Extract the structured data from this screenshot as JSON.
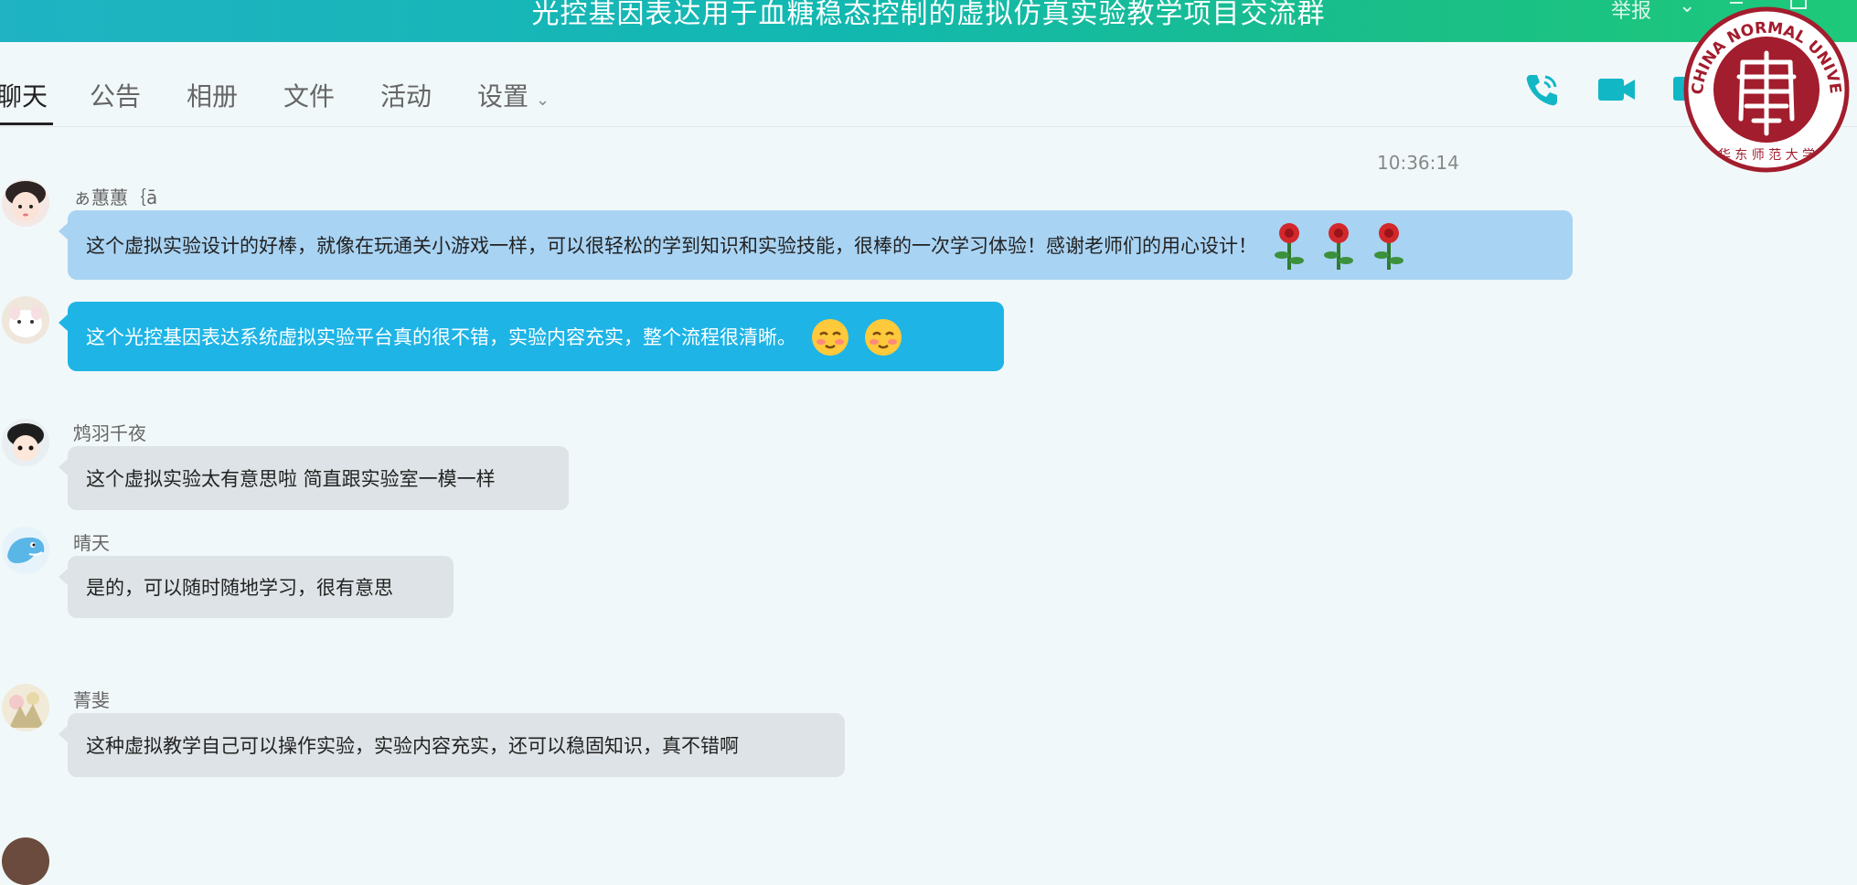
{
  "window": {
    "title": "光控基因表达用于血糖稳态控制的虚拟仿真实验教学项目交流群",
    "report_label": "举报"
  },
  "tabs": [
    {
      "label": "聊天",
      "active": true
    },
    {
      "label": "公告"
    },
    {
      "label": "相册"
    },
    {
      "label": "文件"
    },
    {
      "label": "活动"
    },
    {
      "label": "设置"
    }
  ],
  "toolbar_icons": [
    "phone-icon",
    "video-call-icon",
    "screen-share-icon"
  ],
  "logo": {
    "text": "EAST CHINA NORMAL UNIVERSITY",
    "seal_text": "华东师范大学"
  },
  "chat": {
    "timestamp": "10:36:14",
    "messages": [
      {
        "sender": "ぁ蕙蕙｛ā",
        "text": "这个虚拟实验设计的好棒，就像在玩通关小游戏一样，可以很轻松的学到知识和实验技能，很棒的一次学习体验！感谢老师们的用心设计！",
        "emoji": [
          "rose-icon",
          "rose-icon",
          "rose-icon"
        ],
        "style": "blue-light"
      },
      {
        "sender": "",
        "text": "这个光控基因表达系统虚拟实验平台真的很不错，实验内容充实，整个流程很清晰。",
        "emoji": [
          "shy-face-icon",
          "shy-face-icon"
        ],
        "style": "blue"
      },
      {
        "sender": "鸩羽千夜",
        "text": "这个虚拟实验太有意思啦 简直跟实验室一模一样",
        "style": "gray"
      },
      {
        "sender": "晴天",
        "text": "是的，可以随时随地学习，很有意思",
        "style": "gray"
      },
      {
        "sender": "菁斐",
        "text": "这种虚拟教学自己可以操作实验，实验内容充实，还可以稳固知识，真不错啊",
        "style": "gray"
      }
    ]
  },
  "colors": {
    "titlebar_start": "#1fb3c3",
    "titlebar_end": "#1ec97a",
    "accent": "#12b7c6",
    "bubble_blue": "#1eb4e6",
    "bubble_light_blue": "#a9d3f3",
    "bubble_gray": "#dde3e6",
    "logo_red": "#a21d2d"
  }
}
